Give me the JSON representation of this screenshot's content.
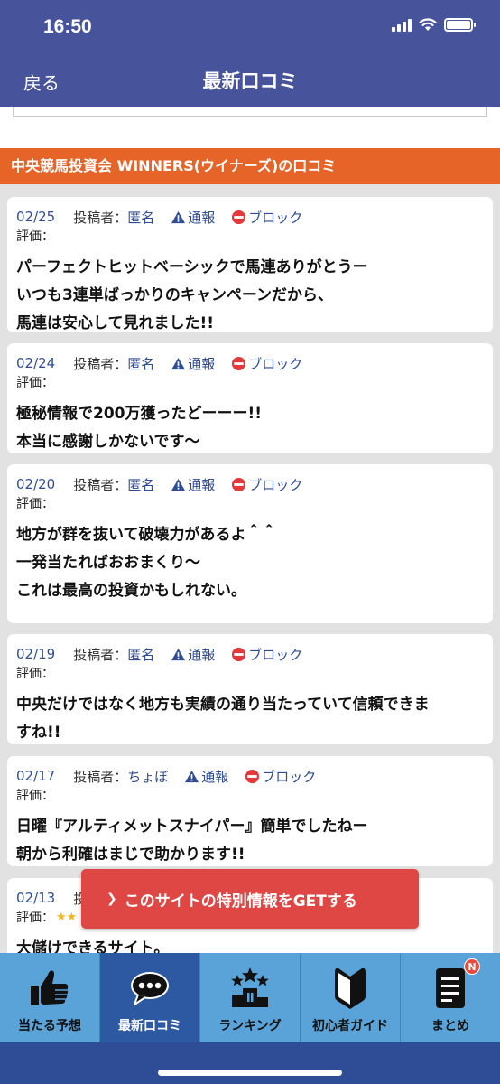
{
  "status_bar": {
    "time": "16:50"
  },
  "nav": {
    "back_label": "戻る",
    "title": "最新口コミ"
  },
  "section": {
    "header": "中央競馬投資会 WINNERS(ウイナーズ)の口コミ"
  },
  "review_labels": {
    "poster_prefix": "投稿者：",
    "rating_label": "評価：",
    "report_label": "通報",
    "block_label": "ブロック"
  },
  "reviews": [
    {
      "date": "02/25",
      "poster": "匿名",
      "text": "パーフェクトヒットベーシックで馬連ありがとうー\nいつも3連単ばっかりのキャンペーンだから、\n馬連は安心して見れました!!"
    },
    {
      "date": "02/24",
      "poster": "匿名",
      "text": "極秘情報で200万獲ったどーーー!!\n本当に感謝しかないです〜"
    },
    {
      "date": "02/20",
      "poster": "匿名",
      "text": "地方が群を抜いて破壊力があるよ＾＾\n一発当たればおおまくり〜\nこれは最高の投資かもしれない。"
    },
    {
      "date": "02/19",
      "poster": "匿名",
      "text": "中央だけではなく地方も実績の通り当たっていて信頼できま\nすね!!"
    },
    {
      "date": "02/17",
      "poster": "ちょぼ",
      "text": "日曜『アルティメットスナイパー』簡単でしたねー\n朝から利確はまじで助かります!!"
    },
    {
      "date": "02/13",
      "poster": "",
      "text": "大儲けできるサイト。",
      "stars": "★★"
    }
  ],
  "cta": {
    "label": "このサイトの特別情報をGETする"
  },
  "tabs": [
    {
      "label": "当たる予想",
      "icon": "thumbs-up-icon"
    },
    {
      "label": "最新口コミ",
      "icon": "speech-bubble-icon"
    },
    {
      "label": "ランキング",
      "icon": "ranking-podium-icon"
    },
    {
      "label": "初心者ガイド",
      "icon": "beginner-mark-icon"
    },
    {
      "label": "まとめ",
      "icon": "document-icon",
      "badge": "N"
    }
  ],
  "colors": {
    "header": "#47549c",
    "section_header": "#e76428",
    "link": "#2f4d96",
    "cta": "#df4744",
    "tabbar": "#5aa3d8",
    "tab_active": "#2d58a2"
  }
}
